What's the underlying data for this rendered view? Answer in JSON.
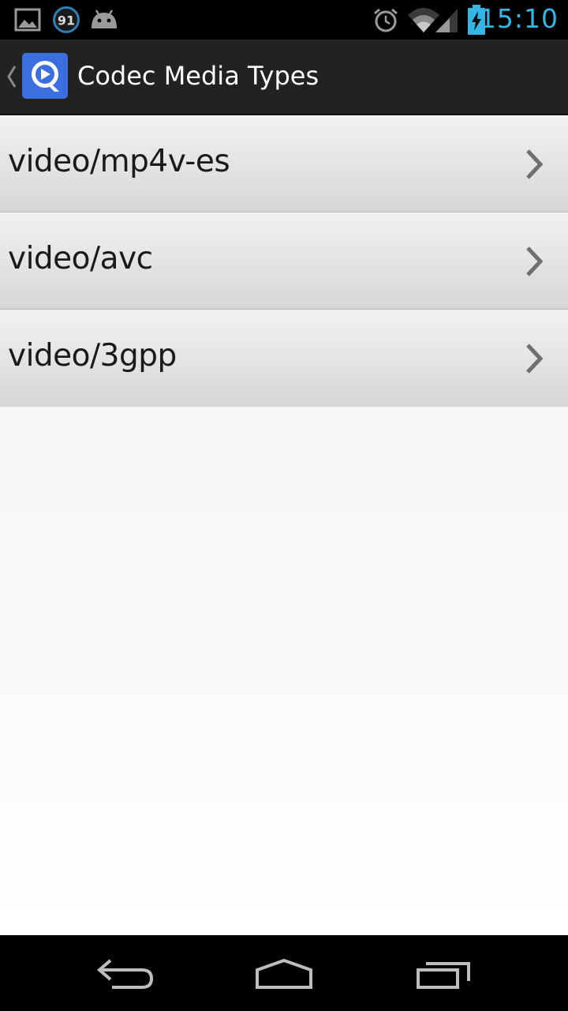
{
  "status_bar": {
    "time": "15:10",
    "notification_badge": "91",
    "colors": {
      "time": "#33b5e5",
      "battery": "#33b5e5"
    },
    "icons": [
      "gallery-icon",
      "update-badge-icon",
      "android-icon",
      "alarm-icon",
      "wifi-icon",
      "signal-icon",
      "battery-charging-icon"
    ]
  },
  "action_bar": {
    "title": "Codec Media Types",
    "app_icon": "app-logo-icon",
    "up_icon": "up-caret-icon",
    "colors": {
      "background": "#222222",
      "app_icon": "#3b6fe0"
    }
  },
  "list": {
    "items": [
      {
        "label": "video/mp4v-es"
      },
      {
        "label": "video/avc"
      },
      {
        "label": "video/3gpp"
      }
    ],
    "item_icon": "chevron-right-icon"
  },
  "nav_bar": {
    "buttons": [
      {
        "name": "back",
        "icon": "back-icon"
      },
      {
        "name": "home",
        "icon": "home-icon"
      },
      {
        "name": "recents",
        "icon": "recents-icon"
      }
    ]
  }
}
